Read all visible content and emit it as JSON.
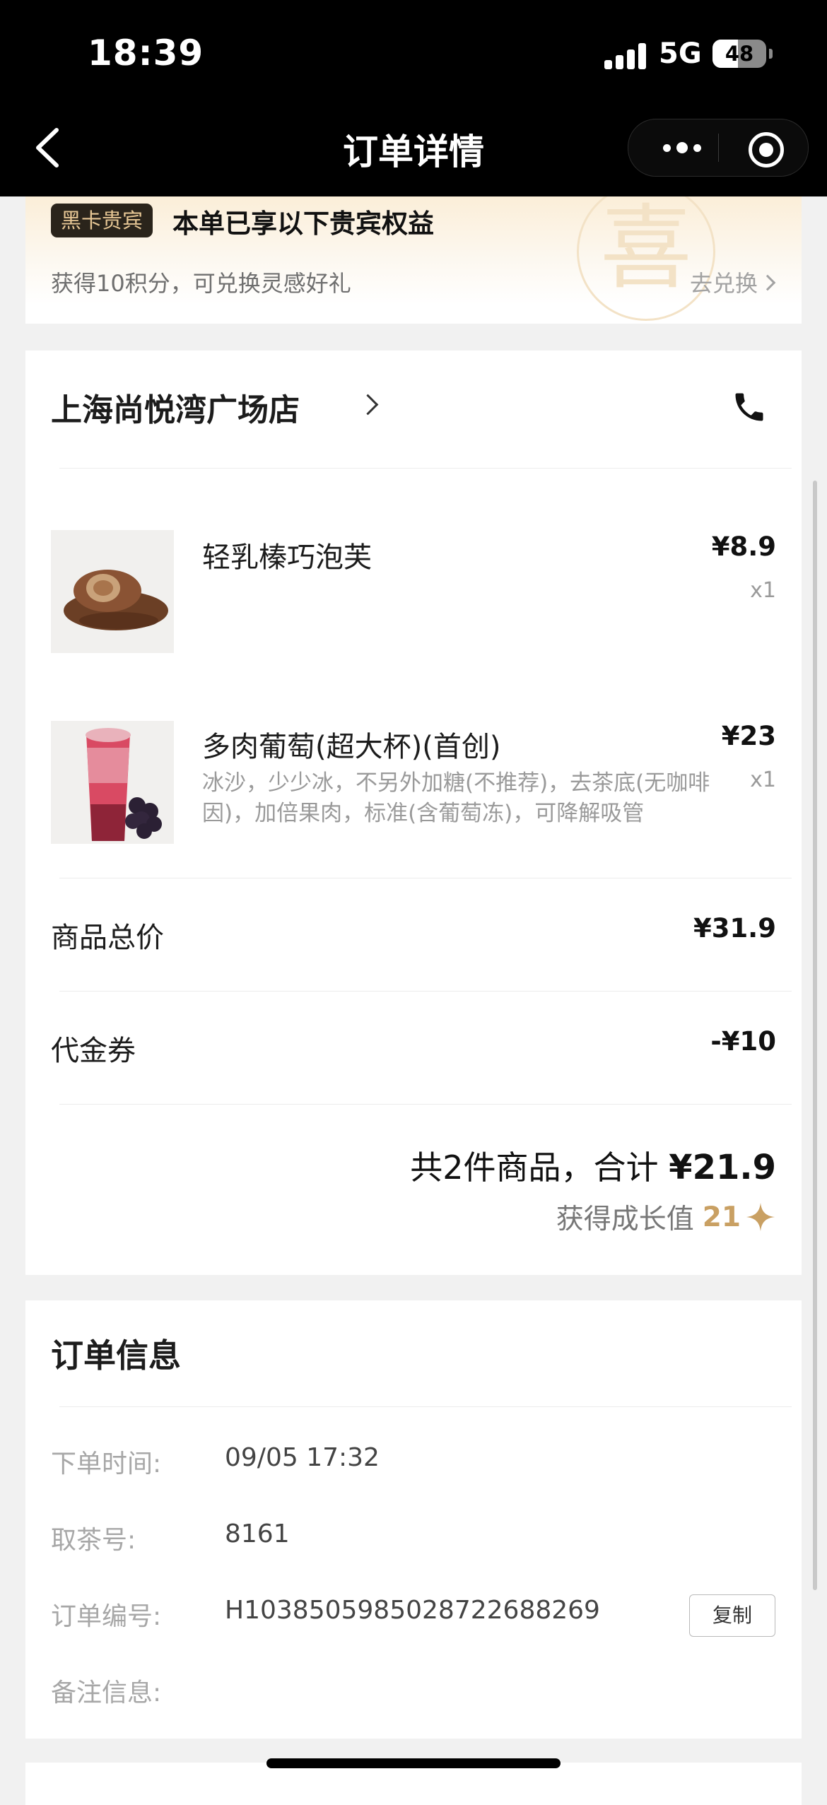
{
  "status_bar": {
    "time": "18:39",
    "network": "5G",
    "battery": "48",
    "battery_level": 0.48
  },
  "nav": {
    "title": "订单详情"
  },
  "benefit": {
    "badge": "黑卡贵宾",
    "title": "本单已享以下贵宾权益",
    "subtitle": "获得10积分，可兑换灵感好礼",
    "redeem_label": "去兑换",
    "watermark": "喜"
  },
  "order": {
    "store_name": "上海尚悦湾广场店",
    "items": [
      {
        "name": "轻乳榛巧泡芙",
        "price": "¥8.9",
        "qty": "x1",
        "desc": ""
      },
      {
        "name": "多肉葡萄(超大杯)(首创)",
        "price": "¥23",
        "qty": "x1",
        "desc": "冰沙，少少冰，不另外加糖(不推荐)，去茶底(无咖啡因)，加倍果肉，标准(含葡萄冻)，可降解吸管"
      }
    ],
    "subtotal_label": "商品总价",
    "subtotal": "¥31.9",
    "voucher_label": "代金券",
    "voucher": "-¥10",
    "total_prefix": "共2件商品，合计",
    "total_amount": "¥21.9",
    "growth_label": "获得成长值",
    "growth_value": "21"
  },
  "info": {
    "title": "订单信息",
    "rows": [
      {
        "label": "下单时间:",
        "value": "09/05 17:32"
      },
      {
        "label": "取茶号:",
        "value": "8161"
      },
      {
        "label": "订单编号:",
        "value": "H103850598502872268826​9"
      },
      {
        "label": "备注信息:",
        "value": ""
      }
    ],
    "copy_label": "复制"
  },
  "colors": {
    "accent_gold": "#c9a063",
    "badge_bg": "#2a241b",
    "nav_bg": "#000000"
  }
}
